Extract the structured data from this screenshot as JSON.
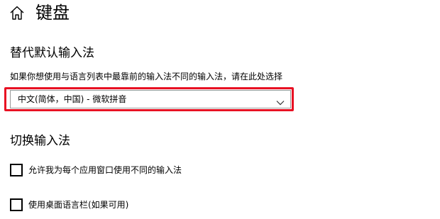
{
  "header": {
    "title": "键盘",
    "home_icon": "home-icon"
  },
  "default_input": {
    "heading": "替代默认输入法",
    "description": "如果你想使用与语言列表中最靠前的输入法不同的输入法，请在此处选择",
    "selected_value": "中文(简体，中国) - 微软拼音",
    "highlight_color": "#e81123"
  },
  "switch_input": {
    "heading": "切换输入法",
    "options": [
      {
        "label": "允许我为每个应用窗口使用不同的输入法",
        "checked": false
      },
      {
        "label": "使用桌面语言栏(如果可用)",
        "checked": false
      }
    ]
  }
}
